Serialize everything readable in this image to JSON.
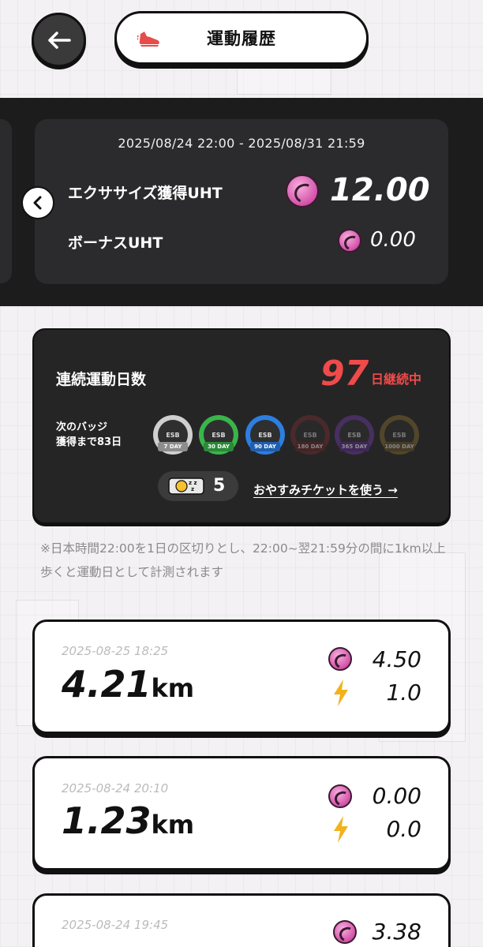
{
  "header": {
    "title": "運動履歴",
    "back_icon": "arrow-left-icon",
    "title_icon": "running-shoe-icon"
  },
  "period": {
    "range": "2025/08/24 22:00 - 2025/08/31 21:59",
    "exercise_label": "エクササイズ獲得UHT",
    "exercise_amount": "12.00",
    "bonus_label": "ボーナスUHT",
    "bonus_amount": "0.00"
  },
  "streak": {
    "label": "連続運動日数",
    "days": "97",
    "unit": "日継続中",
    "next_badge_line1": "次のバッジ",
    "next_badge_line2": "獲得まで83日",
    "badges": [
      {
        "tag": "7 DAY",
        "color": "#cfcfcf",
        "achieved": true
      },
      {
        "tag": "30 DAY",
        "color": "#39b54a",
        "achieved": true
      },
      {
        "tag": "90 DAY",
        "color": "#2d7ee0",
        "achieved": true
      },
      {
        "tag": "180 DAY",
        "color": "#5a2a2a",
        "achieved": false
      },
      {
        "tag": "365 DAY",
        "color": "#4a2a6a",
        "achieved": false
      },
      {
        "tag": "1000 DAY",
        "color": "#5a4a25",
        "achieved": false
      }
    ],
    "ticket_count": "5",
    "ticket_link": "おやすみチケットを使う →"
  },
  "note": "※日本時間22:00を1日の区切りとし、22:00~翌21:59分の間に1km以上歩くと運動日として計測されます",
  "history": [
    {
      "date": "2025-08-25 18:25",
      "distance": "4.21",
      "unit": "km",
      "uht": "4.50",
      "energy": "1.0"
    },
    {
      "date": "2025-08-24 20:10",
      "distance": "1.23",
      "unit": "km",
      "uht": "0.00",
      "energy": "0.0"
    },
    {
      "date": "2025-08-24 19:45",
      "distance": "",
      "unit": "",
      "uht": "3.38",
      "energy": ""
    }
  ],
  "colors": {
    "accent_red": "#f04a4a",
    "coin_pink": "#d451a8",
    "bolt_yellow": "#f2b21b",
    "dark_band": "#1c1c1d"
  }
}
